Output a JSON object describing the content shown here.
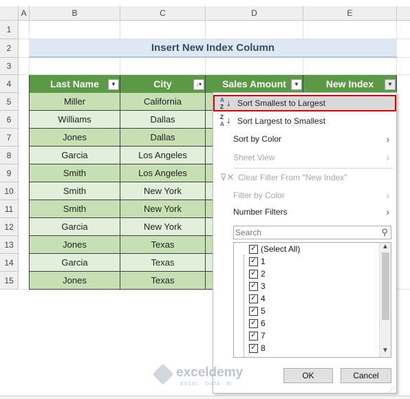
{
  "columns": [
    "A",
    "B",
    "C",
    "D",
    "E"
  ],
  "rows": [
    "1",
    "2",
    "3",
    "4",
    "5",
    "6",
    "7",
    "8",
    "9",
    "10",
    "11",
    "12",
    "13",
    "14",
    "15"
  ],
  "sheet_title": "Insert New Index Column",
  "headers": [
    "Last Name",
    "City",
    "Sales Amount",
    "New Index"
  ],
  "table": [
    {
      "last": "Miller",
      "city": "California"
    },
    {
      "last": "Williams",
      "city": "Dallas"
    },
    {
      "last": "Jones",
      "city": "Dallas"
    },
    {
      "last": "Garcia",
      "city": "Los Angeles"
    },
    {
      "last": "Smith",
      "city": "Los Angeles"
    },
    {
      "last": "Smith",
      "city": "New York"
    },
    {
      "last": "Smith",
      "city": "New York"
    },
    {
      "last": "Garcia",
      "city": "New York"
    },
    {
      "last": "Jones",
      "city": "Texas"
    },
    {
      "last": "Garcia",
      "city": "Texas"
    },
    {
      "last": "Jones",
      "city": "Texas"
    }
  ],
  "menu": {
    "sort_asc": "Sort Smallest to Largest",
    "sort_desc": "Sort Largest to Smallest",
    "sort_color": "Sort by Color",
    "sheet_view": "Sheet View",
    "clear_filter": "Clear Filter From \"New Index\"",
    "filter_color": "Filter by Color",
    "number_filters": "Number Filters",
    "search_placeholder": "Search",
    "select_all": "(Select All)",
    "values": [
      "1",
      "2",
      "3",
      "4",
      "5",
      "6",
      "7",
      "8"
    ],
    "ok": "OK",
    "cancel": "Cancel"
  },
  "az_top": "A",
  "az_bottom": "Z",
  "za_top": "Z",
  "za_bottom": "A",
  "watermark": {
    "name": "exceldemy",
    "tagline": "EXCEL · DATA · BI"
  },
  "colors": {
    "header_green": "#5a9a45",
    "row_light": "#e2efda",
    "row_dark": "#c6e0b4",
    "highlight": "#e00000"
  }
}
